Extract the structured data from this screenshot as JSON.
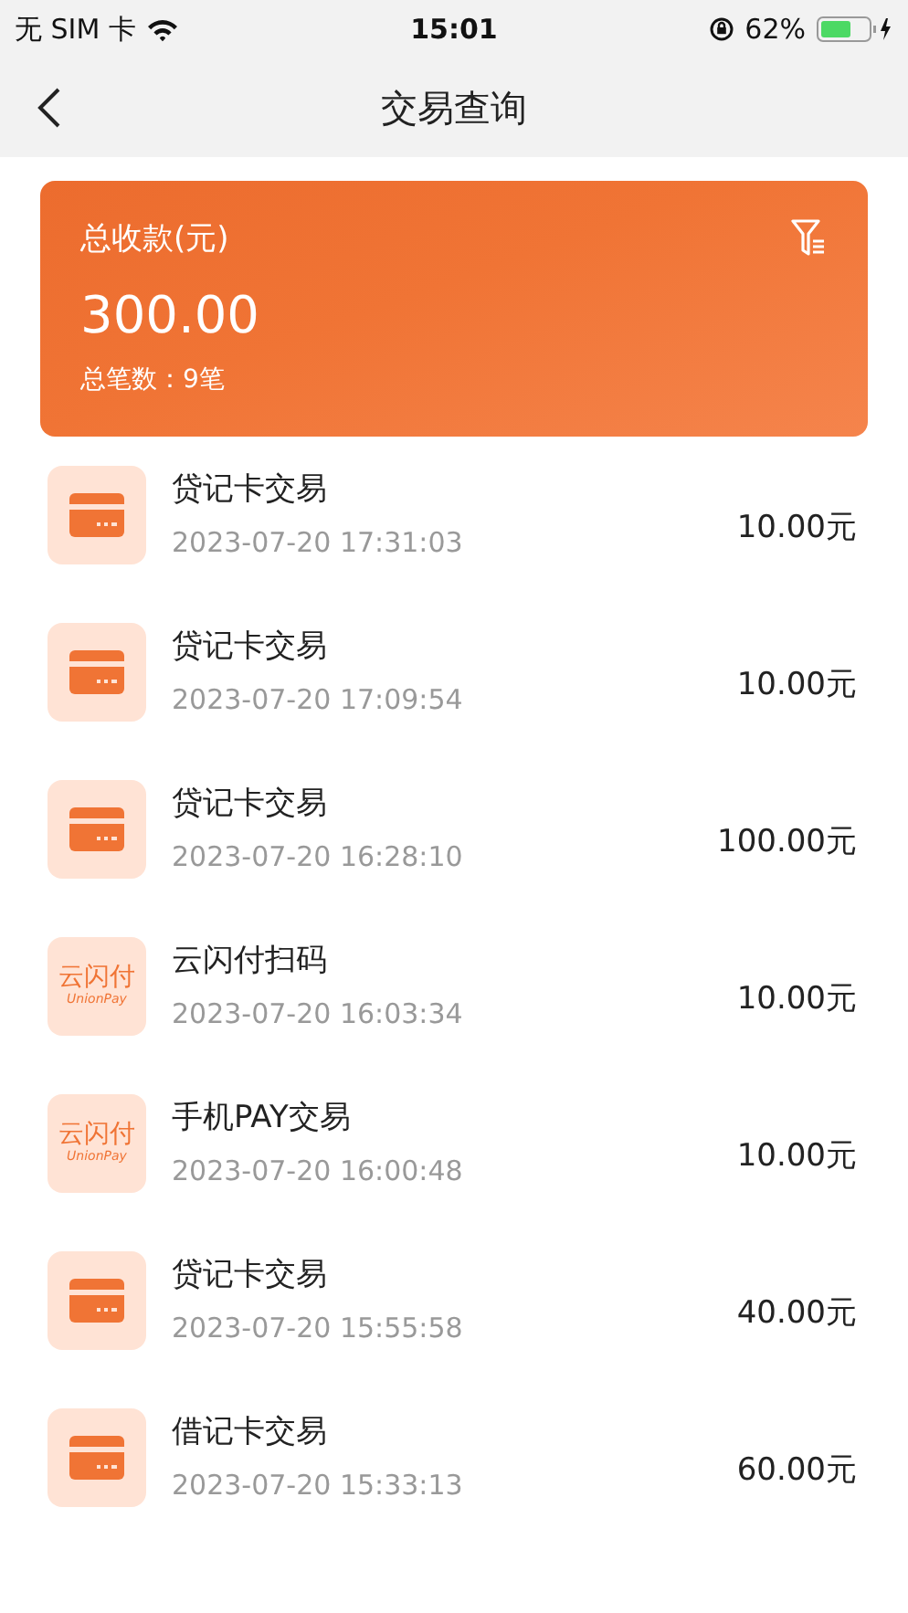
{
  "status_bar": {
    "carrier": "无 SIM 卡",
    "time": "15:01",
    "battery_percent": "62%"
  },
  "nav": {
    "title": "交易查询"
  },
  "summary": {
    "label": "总收款(元)",
    "amount": "300.00",
    "count": "总笔数：9笔"
  },
  "transactions": [
    {
      "kind": "card",
      "name": "贷记卡交易",
      "time": "2023-07-20 17:31:03",
      "amount": "10.00元"
    },
    {
      "kind": "card",
      "name": "贷记卡交易",
      "time": "2023-07-20 17:09:54",
      "amount": "10.00元"
    },
    {
      "kind": "card",
      "name": "贷记卡交易",
      "time": "2023-07-20 16:28:10",
      "amount": "100.00元"
    },
    {
      "kind": "unionpay",
      "icon_text": "云闪付",
      "icon_subtext": "UnionPay",
      "name": "云闪付扫码",
      "time": "2023-07-20 16:03:34",
      "amount": "10.00元"
    },
    {
      "kind": "unionpay",
      "icon_text": "云闪付",
      "icon_subtext": "UnionPay",
      "name": "手机PAY交易",
      "time": "2023-07-20 16:00:48",
      "amount": "10.00元"
    },
    {
      "kind": "card",
      "name": "贷记卡交易",
      "time": "2023-07-20 15:55:58",
      "amount": "40.00元"
    },
    {
      "kind": "card",
      "name": "借记卡交易",
      "time": "2023-07-20 15:33:13",
      "amount": "60.00元"
    }
  ]
}
